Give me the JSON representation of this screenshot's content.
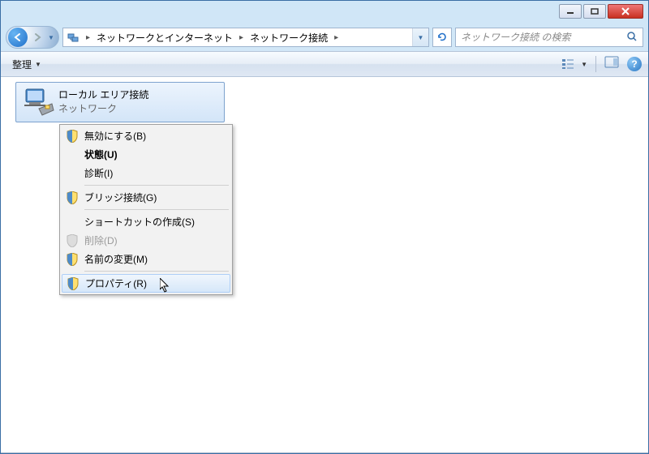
{
  "breadcrumb": {
    "seg1": "ネットワークとインターネット",
    "seg2": "ネットワーク接続"
  },
  "search": {
    "placeholder": "ネットワーク接続 の検索"
  },
  "toolbar": {
    "organize": "整理"
  },
  "item": {
    "name": "ローカル エリア接続",
    "sub": "ネットワーク"
  },
  "menu": {
    "disable": "無効にする(B)",
    "status": "状態(U)",
    "diagnose": "診断(I)",
    "bridge": "ブリッジ接続(G)",
    "shortcut": "ショートカットの作成(S)",
    "delete": "削除(D)",
    "rename": "名前の変更(M)",
    "properties": "プロパティ(R)"
  }
}
